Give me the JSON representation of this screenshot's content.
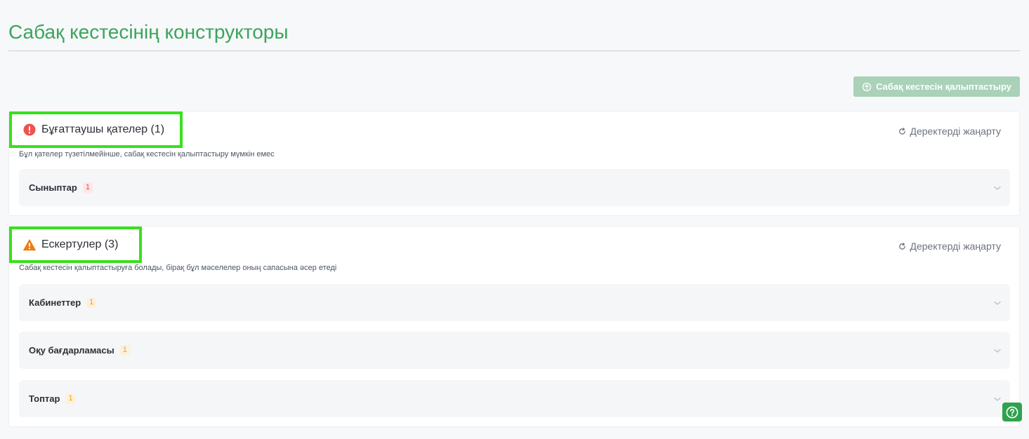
{
  "page": {
    "title": "Сабақ кестесінің конструкторы",
    "generate_button_label": "Сабақ кестесін қалыптастыру"
  },
  "blocking": {
    "title": "Бұғаттаушы қателер (1)",
    "refresh_label": "Деректерді жаңарту",
    "subtitle": "Бұл қателер түзетілмейінше, сабақ кестесін қалыптастыру мүмкін емес",
    "icon": "error-circle-icon",
    "color": "#ef4444",
    "groups": [
      {
        "label": "Сыныптар",
        "count": "1"
      }
    ]
  },
  "warnings": {
    "title": "Ескертулер (3)",
    "refresh_label": "Деректерді жаңарту",
    "subtitle": "Сабақ кестесін қалыптастыруға болады, бірақ бұл мәселелер оның сапасына әсер етеді",
    "icon": "warning-triangle-icon",
    "color": "#f59e0b",
    "groups": [
      {
        "label": "Кабинеттер",
        "count": "1"
      },
      {
        "label": "Оқу бағдарламасы",
        "count": "1"
      },
      {
        "label": "Топтар",
        "count": "1"
      }
    ]
  },
  "theme": {
    "accent": "#3aa55b",
    "highlight": "#39e01c"
  },
  "help": {
    "icon": "help-question-icon"
  }
}
